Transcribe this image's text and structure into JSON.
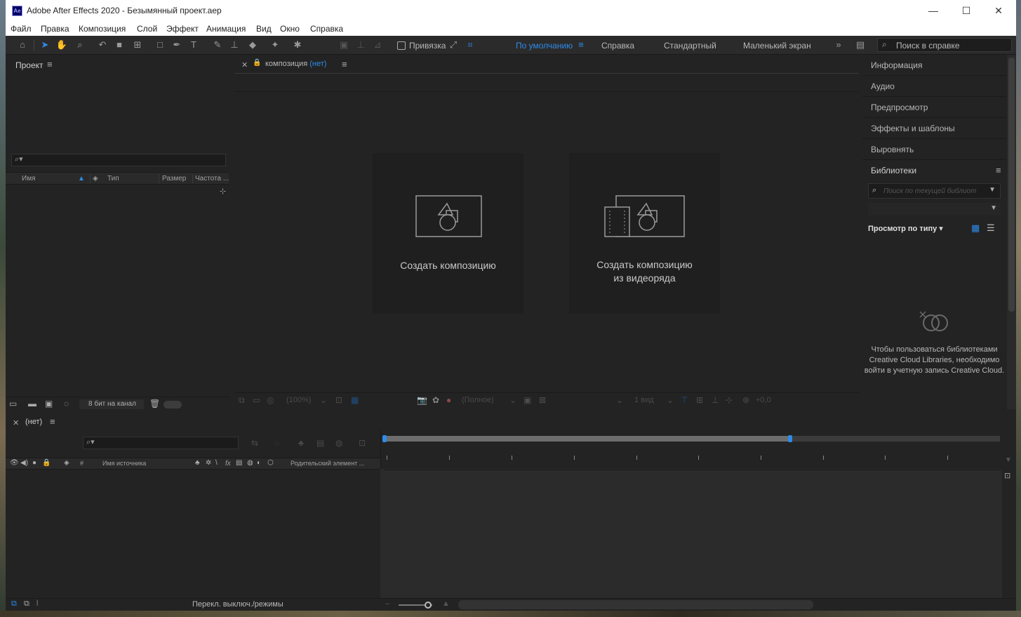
{
  "window": {
    "app_logo": "Ae",
    "title": "Adobe After Effects 2020 - Безымянный проект.aep",
    "minimize": "—",
    "maximize": "☐",
    "close": "✕"
  },
  "menu": [
    "Файл",
    "Правка",
    "Композиция",
    "Слой",
    "Эффект",
    "Анимация",
    "Вид",
    "Окно",
    "Справка"
  ],
  "toolbar": {
    "snap_label": "Привязка",
    "workspaces": [
      "По умолчанию",
      "Справка",
      "Стандартный",
      "Маленький экран"
    ],
    "active_workspace": "По умолчанию",
    "overflow": "»",
    "help_search_placeholder": "Поиск в справке"
  },
  "project_panel": {
    "title": "Проект",
    "search_icon": "⌕▾",
    "columns": [
      "Имя",
      "Тип",
      "Размер",
      "Частота ..."
    ],
    "bit_depth": "8 бит на канал"
  },
  "composition_panel": {
    "tab_prefix": "композиция",
    "tab_value": "(нет)",
    "card_new_comp": "Создать композицию",
    "card_from_footage_line1": "Создать композицию",
    "card_from_footage_line2": "из видеоряда",
    "footer": {
      "zoom": "(100%)",
      "resolution": "(Полное)",
      "views": "1 вид",
      "exposure": "+0,0"
    }
  },
  "right_panels": {
    "items": [
      "Информация",
      "Аудио",
      "Предпросмотр",
      "Эффекты и шаблоны",
      "Выровнять",
      "Библиотеки"
    ],
    "library_search_placeholder": "Поиск по текущей библиот",
    "view_by_type": "Просмотр по типу",
    "message": "Чтобы пользоваться библиотеками Creative Cloud Libraries, необходимо войти в учетную запись Creative Cloud."
  },
  "timeline": {
    "tab_title": "(нет)",
    "search_icon": "⌕▾",
    "columns": {
      "number": "#",
      "source_name": "Имя источника",
      "fx": "fx",
      "parent": "Родительский элемент ..."
    },
    "work_area_end_fraction": 0.66,
    "status_label": "Перекл. выключ./режимы"
  },
  "colors": {
    "accent": "#2d8ceb",
    "panel_bg": "#232323",
    "app_logo_bg": "#00005b",
    "app_logo_fg": "#9999ff"
  }
}
